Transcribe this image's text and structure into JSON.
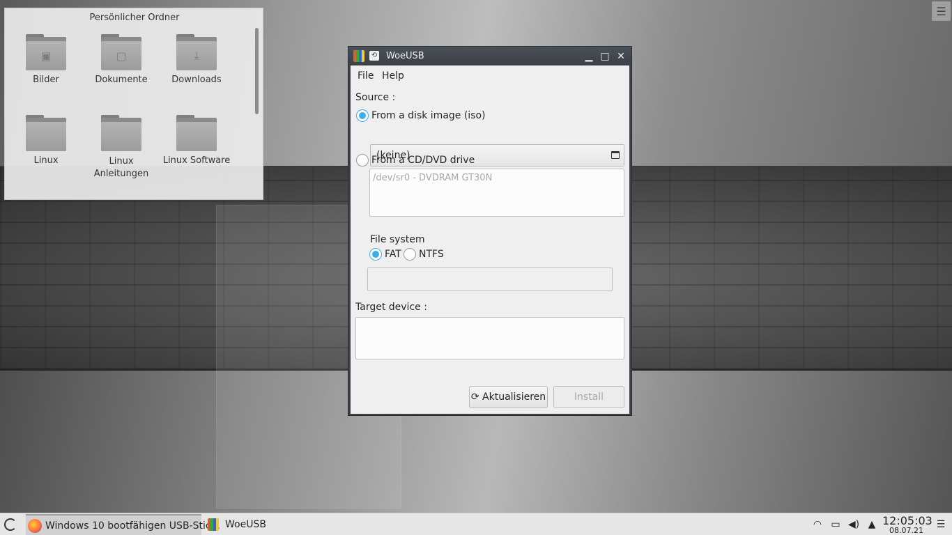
{
  "desktop": {
    "folder_widget": {
      "title": "Persönlicher Ordner",
      "items": [
        {
          "label": "Bilder",
          "icon": "image-folder-icon"
        },
        {
          "label": "Dokumente",
          "icon": "document-folder-icon"
        },
        {
          "label": "Downloads",
          "icon": "download-folder-icon"
        },
        {
          "label": "Linux",
          "icon": "folder-icon"
        },
        {
          "label": "Linux Anleitungen",
          "icon": "folder-icon"
        },
        {
          "label": "Linux Software",
          "icon": "folder-icon"
        }
      ]
    },
    "menu_button_icon": "hamburger-icon"
  },
  "window": {
    "title": "WoeUSB",
    "menu": {
      "file": "File",
      "help": "Help"
    },
    "source_label": "Source :",
    "disk_image_option": "From a disk image (iso)",
    "disk_image_value": "(keine)",
    "cd_option": "From a CD/DVD drive",
    "cd_drive_entry": "/dev/sr0 - DVDRAM GT30N",
    "filesystem": {
      "title": "File system",
      "fat": "FAT",
      "ntfs": "NTFS",
      "selected": "FAT"
    },
    "selected_source": "disk_image",
    "target_label": "Target device :",
    "refresh_button": "Aktualisieren",
    "install_button": "Install"
  },
  "taskbar": {
    "tasks": [
      {
        "label": "Windows 10 bootfähigen USB-Stic...",
        "icon": "firefox-icon"
      },
      {
        "label": "WoeUSB",
        "icon": "woeusb-icon"
      }
    ],
    "clock_time": "12:05:03",
    "clock_date": "08.07.21"
  },
  "colors": {
    "accent": "#3daee9",
    "titlebar": "#3b4046",
    "taskbar": "#e6e6e6"
  }
}
